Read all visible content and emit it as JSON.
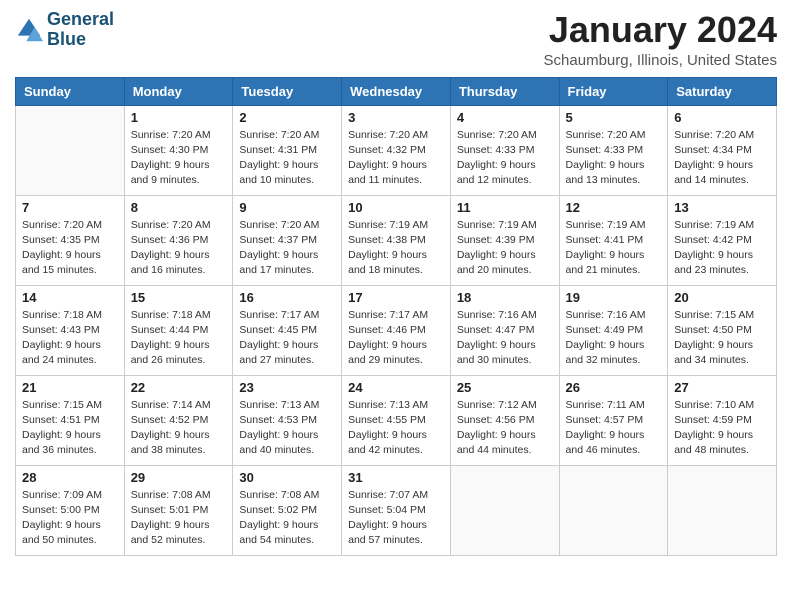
{
  "logo": {
    "line1": "General",
    "line2": "Blue"
  },
  "title": "January 2024",
  "subtitle": "Schaumburg, Illinois, United States",
  "days_of_week": [
    "Sunday",
    "Monday",
    "Tuesday",
    "Wednesday",
    "Thursday",
    "Friday",
    "Saturday"
  ],
  "weeks": [
    [
      {
        "day": "",
        "info": ""
      },
      {
        "day": "1",
        "info": "Sunrise: 7:20 AM\nSunset: 4:30 PM\nDaylight: 9 hours\nand 9 minutes."
      },
      {
        "day": "2",
        "info": "Sunrise: 7:20 AM\nSunset: 4:31 PM\nDaylight: 9 hours\nand 10 minutes."
      },
      {
        "day": "3",
        "info": "Sunrise: 7:20 AM\nSunset: 4:32 PM\nDaylight: 9 hours\nand 11 minutes."
      },
      {
        "day": "4",
        "info": "Sunrise: 7:20 AM\nSunset: 4:33 PM\nDaylight: 9 hours\nand 12 minutes."
      },
      {
        "day": "5",
        "info": "Sunrise: 7:20 AM\nSunset: 4:33 PM\nDaylight: 9 hours\nand 13 minutes."
      },
      {
        "day": "6",
        "info": "Sunrise: 7:20 AM\nSunset: 4:34 PM\nDaylight: 9 hours\nand 14 minutes."
      }
    ],
    [
      {
        "day": "7",
        "info": "Sunrise: 7:20 AM\nSunset: 4:35 PM\nDaylight: 9 hours\nand 15 minutes."
      },
      {
        "day": "8",
        "info": "Sunrise: 7:20 AM\nSunset: 4:36 PM\nDaylight: 9 hours\nand 16 minutes."
      },
      {
        "day": "9",
        "info": "Sunrise: 7:20 AM\nSunset: 4:37 PM\nDaylight: 9 hours\nand 17 minutes."
      },
      {
        "day": "10",
        "info": "Sunrise: 7:19 AM\nSunset: 4:38 PM\nDaylight: 9 hours\nand 18 minutes."
      },
      {
        "day": "11",
        "info": "Sunrise: 7:19 AM\nSunset: 4:39 PM\nDaylight: 9 hours\nand 20 minutes."
      },
      {
        "day": "12",
        "info": "Sunrise: 7:19 AM\nSunset: 4:41 PM\nDaylight: 9 hours\nand 21 minutes."
      },
      {
        "day": "13",
        "info": "Sunrise: 7:19 AM\nSunset: 4:42 PM\nDaylight: 9 hours\nand 23 minutes."
      }
    ],
    [
      {
        "day": "14",
        "info": "Sunrise: 7:18 AM\nSunset: 4:43 PM\nDaylight: 9 hours\nand 24 minutes."
      },
      {
        "day": "15",
        "info": "Sunrise: 7:18 AM\nSunset: 4:44 PM\nDaylight: 9 hours\nand 26 minutes."
      },
      {
        "day": "16",
        "info": "Sunrise: 7:17 AM\nSunset: 4:45 PM\nDaylight: 9 hours\nand 27 minutes."
      },
      {
        "day": "17",
        "info": "Sunrise: 7:17 AM\nSunset: 4:46 PM\nDaylight: 9 hours\nand 29 minutes."
      },
      {
        "day": "18",
        "info": "Sunrise: 7:16 AM\nSunset: 4:47 PM\nDaylight: 9 hours\nand 30 minutes."
      },
      {
        "day": "19",
        "info": "Sunrise: 7:16 AM\nSunset: 4:49 PM\nDaylight: 9 hours\nand 32 minutes."
      },
      {
        "day": "20",
        "info": "Sunrise: 7:15 AM\nSunset: 4:50 PM\nDaylight: 9 hours\nand 34 minutes."
      }
    ],
    [
      {
        "day": "21",
        "info": "Sunrise: 7:15 AM\nSunset: 4:51 PM\nDaylight: 9 hours\nand 36 minutes."
      },
      {
        "day": "22",
        "info": "Sunrise: 7:14 AM\nSunset: 4:52 PM\nDaylight: 9 hours\nand 38 minutes."
      },
      {
        "day": "23",
        "info": "Sunrise: 7:13 AM\nSunset: 4:53 PM\nDaylight: 9 hours\nand 40 minutes."
      },
      {
        "day": "24",
        "info": "Sunrise: 7:13 AM\nSunset: 4:55 PM\nDaylight: 9 hours\nand 42 minutes."
      },
      {
        "day": "25",
        "info": "Sunrise: 7:12 AM\nSunset: 4:56 PM\nDaylight: 9 hours\nand 44 minutes."
      },
      {
        "day": "26",
        "info": "Sunrise: 7:11 AM\nSunset: 4:57 PM\nDaylight: 9 hours\nand 46 minutes."
      },
      {
        "day": "27",
        "info": "Sunrise: 7:10 AM\nSunset: 4:59 PM\nDaylight: 9 hours\nand 48 minutes."
      }
    ],
    [
      {
        "day": "28",
        "info": "Sunrise: 7:09 AM\nSunset: 5:00 PM\nDaylight: 9 hours\nand 50 minutes."
      },
      {
        "day": "29",
        "info": "Sunrise: 7:08 AM\nSunset: 5:01 PM\nDaylight: 9 hours\nand 52 minutes."
      },
      {
        "day": "30",
        "info": "Sunrise: 7:08 AM\nSunset: 5:02 PM\nDaylight: 9 hours\nand 54 minutes."
      },
      {
        "day": "31",
        "info": "Sunrise: 7:07 AM\nSunset: 5:04 PM\nDaylight: 9 hours\nand 57 minutes."
      },
      {
        "day": "",
        "info": ""
      },
      {
        "day": "",
        "info": ""
      },
      {
        "day": "",
        "info": ""
      }
    ]
  ]
}
